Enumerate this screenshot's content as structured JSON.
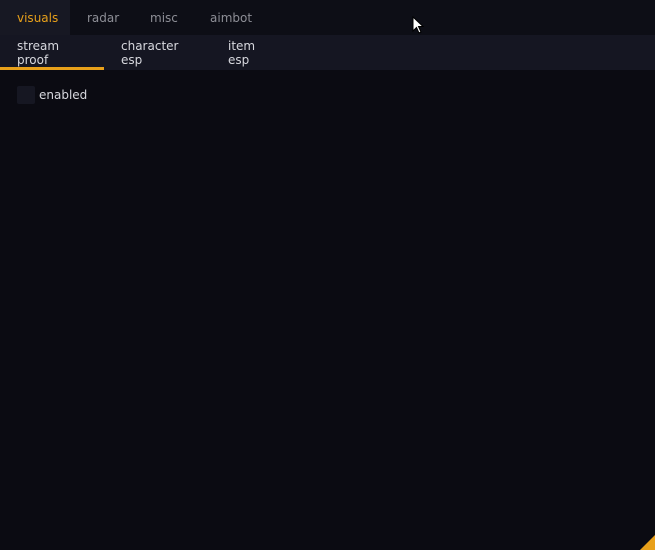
{
  "top_tabs": [
    {
      "label": "visuals",
      "active": true
    },
    {
      "label": "radar",
      "active": false
    },
    {
      "label": "misc",
      "active": false
    },
    {
      "label": "aimbot",
      "active": false
    }
  ],
  "sub_tabs": [
    {
      "label": "stream proof",
      "active": true
    },
    {
      "label": "character esp",
      "active": false
    },
    {
      "label": "item esp",
      "active": false
    }
  ],
  "settings": {
    "enabled_label": "enabled",
    "enabled_checked": false
  },
  "colors": {
    "accent": "#e8a01a",
    "background": "#0b0b12",
    "tab_bar": "#0d0e16",
    "sub_tab_bar": "#151622",
    "checkbox": "#161722"
  }
}
